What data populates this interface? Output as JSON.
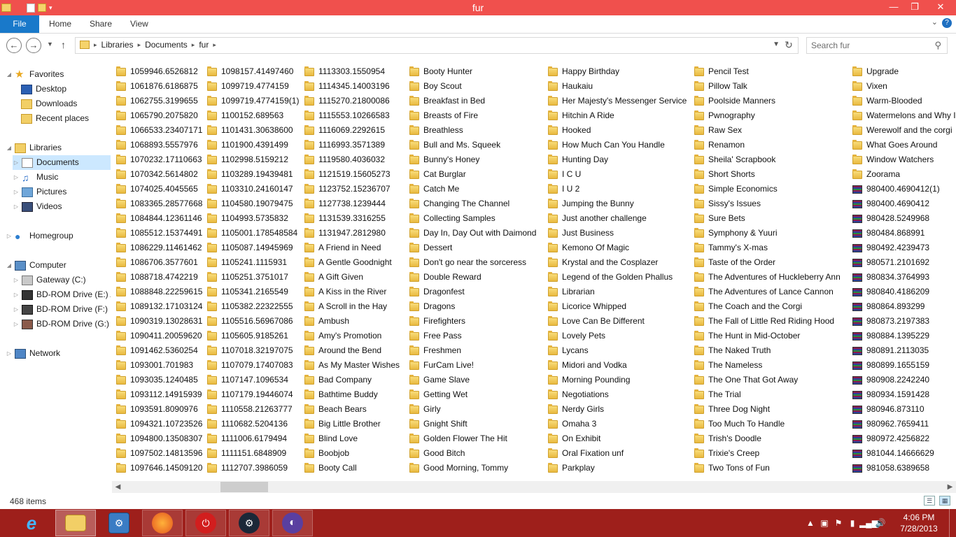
{
  "window": {
    "title": "fur",
    "controls": [
      "—",
      "❐",
      "✕"
    ]
  },
  "ribbon": {
    "file_label": "File",
    "tabs": [
      "Home",
      "Share",
      "View"
    ],
    "help": "?",
    "collapse": "⌄"
  },
  "address": {
    "path": [
      "Libraries",
      "Documents",
      "fur"
    ],
    "search_placeholder": "Search fur"
  },
  "navpane": {
    "favorites": {
      "label": "Favorites",
      "items": [
        "Desktop",
        "Downloads",
        "Recent places"
      ]
    },
    "libraries": {
      "label": "Libraries",
      "items": [
        "Documents",
        "Music",
        "Pictures",
        "Videos"
      ]
    },
    "homegroup": "Homegroup",
    "computer": {
      "label": "Computer",
      "items": [
        "Gateway (C:)",
        "BD-ROM Drive (E:) A",
        "BD-ROM Drive (F:) L",
        "BD-ROM Drive (G:) D"
      ]
    },
    "network": "Network"
  },
  "columns": [
    [
      "1059946.6526812",
      "1061876.6186875",
      "1062755.3199655",
      "1065790.2075820",
      "1066533.23407171",
      "1068893.5557976",
      "1070232.17110663",
      "1070342.5614802",
      "1074025.4045565",
      "1083365.28577668",
      "1084844.12361146",
      "1085512.15374491",
      "1086229.11461462",
      "1086706.3577601",
      "1088718.4742219",
      "1088848.22259615",
      "1089132.17103124",
      "1090319.13028631",
      "1090411.20059620",
      "1091462.5360254",
      "1093001.701983",
      "1093035.1240485",
      "1093112.14915939",
      "1093591.8090976",
      "1094321.10723526",
      "1094800.13508307",
      "1097502.14813596",
      "1097646.14509120"
    ],
    [
      "1098157.41497460",
      "1099719.4774159",
      "1099719.4774159(1)",
      "1100152.689563",
      "1101431.30638600",
      "1101900.4391499",
      "1102998.5159212",
      "1103289.19439481",
      "1103310.24160147",
      "1104580.19079475",
      "1104993.5735832",
      "1105001.178548584",
      "1105087.14945969",
      "1105241.1115931",
      "1105251.3751017",
      "1105341.2165549",
      "1105382.22322555",
      "1105516.56967086",
      "1105605.9185261",
      "1107018.32197075",
      "1107079.17407083",
      "1107147.1096534",
      "1107179.19446074",
      "1110558.21263777",
      "1110682.5204136",
      "1111006.6179494",
      "1111151.6848909",
      "1112707.3986059"
    ],
    [
      "1113303.1550954",
      "1114345.14003196",
      "1115270.21800086",
      "1115553.10266583",
      "1116069.2292615",
      "1116993.3571389",
      "1119580.4036032",
      "1121519.15605273",
      "1123752.15236707",
      "1127738.1239444",
      "1131539.3316255",
      "1131947.2812980",
      "A Friend in Need",
      "A Gentle Goodnight",
      "A Gift Given",
      "A Kiss in the River",
      "A Scroll in the Hay",
      "Ambush",
      "Amy's Promotion",
      "Around the Bend",
      "As My Master Wishes",
      "Bad Company",
      "Bathtime Buddy",
      "Beach Bears",
      "Big Little Brother",
      "Blind Love",
      "Boobjob",
      "Booty Call"
    ],
    [
      "Booty Hunter",
      "Boy Scout",
      "Breakfast in Bed",
      "Breasts of Fire",
      "Breathless",
      "Bull and Ms. Squeek",
      "Bunny's Honey",
      "Cat Burglar",
      "Catch Me",
      "Changing The Channel",
      "Collecting Samples",
      "Day In, Day Out with Daimond",
      "Dessert",
      "Don't go near the sorceress",
      "Double Reward",
      "Dragonfest",
      "Dragons",
      "Firefighters",
      "Free Pass",
      "Freshmen",
      "FurCam Live!",
      "Game Slave",
      "Getting Wet",
      "Girly",
      "Gnight Shift",
      "Golden Flower The Hit",
      "Good Bitch",
      "Good Morning, Tommy"
    ],
    [
      "Happy Birthday",
      "Haukaiu",
      "Her Majesty's Messenger Service",
      "Hitchin A Ride",
      "Hooked",
      "How Much Can You Handle",
      "Hunting Day",
      "I C U",
      "I U 2",
      "Jumping the Bunny",
      "Just another challenge",
      "Just Business",
      "Kemono Of Magic",
      "Krystal and the Cosplazer",
      "Legend of the Golden Phallus",
      "Librarian",
      "Licorice Whipped",
      "Love Can Be Different",
      "Lovely Pets",
      "Lycans",
      "Midori and Vodka",
      "Morning Pounding",
      "Negotiations",
      "Nerdy Girls",
      "Omaha 3",
      "On Exhibit",
      "Oral Fixation unf",
      "Parkplay"
    ],
    [
      "Pencil Test",
      "Pillow Talk",
      "Poolside Manners",
      "Pwnography",
      "Raw Sex",
      "Renamon",
      "Sheila' Scrapbook",
      "Short Shorts",
      "Simple Economics",
      "Sissy's Issues",
      "Sure Bets",
      "Symphony & Yuuri",
      "Tammy's X-mas",
      "Taste of the Order",
      "The Adventures of Huckleberry Ann",
      "The Adventures of Lance Cannon",
      "The Coach and the Corgi",
      "The Fall of Little Red Riding Hood",
      "The Hunt in Mid-October",
      "The Naked Truth",
      "The Nameless",
      "The One That Got Away",
      "The Trial",
      "Three Dog Night",
      "Too Much To Handle",
      "Trish's Doodle",
      "Trixie's Creep",
      "Two Tons of Fun"
    ],
    [
      "Upgrade",
      "Vixen",
      "Warm-Blooded",
      "Watermelons and Why I",
      "Werewolf and the corgi",
      "What Goes Around",
      "Window Watchers",
      "Zoorama",
      "980400.4690412(1)",
      "980400.4690412",
      "980428.5249968",
      "980484.868991",
      "980492.4239473",
      "980571.2101692",
      "980834.3764993",
      "980840.4186209",
      "980864.893299",
      "980873.2197383",
      "980884.1395229",
      "980891.2113035",
      "980899.1655159",
      "980908.2242240",
      "980934.1591428",
      "980946.873110",
      "980962.7659411",
      "980972.4256822",
      "981044.14666629",
      "981058.6389658"
    ]
  ],
  "archive_start_in_last_column": 8,
  "statusbar": {
    "count": "468 items"
  },
  "taskbar": {
    "apps": [
      "internet-explorer",
      "file-explorer",
      "control-panel",
      "firefox",
      "power-app",
      "steam",
      "media-app"
    ],
    "time": "4:06 PM",
    "date": "7/28/2013"
  }
}
